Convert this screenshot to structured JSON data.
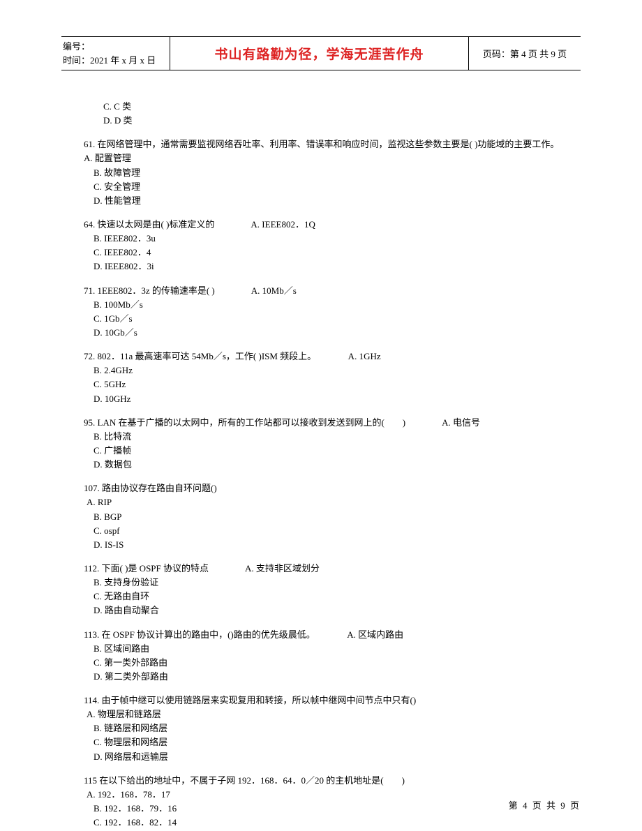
{
  "header": {
    "serial_label": "编号：",
    "time_label": "时间：",
    "time_value": "2021 年 x 月 x 日",
    "motto": "书山有路勤为径，学海无涯苦作舟",
    "page_label": "页码：",
    "page_value": "第 4 页 共 9 页"
  },
  "prev_opts": {
    "c": "C. C 类",
    "d": "D. D 类"
  },
  "q61": {
    "stem": "61. 在网络管理中，通常需要监视网络吞吐率、利用率、错误率和响应时间，监视这些参数主要是( )功能域的主要工作。　　　　A. 配置管理",
    "b": "B. 故障管理",
    "c": "C. 安全管理",
    "d": "D. 性能管理"
  },
  "q64": {
    "stem": "64.  快速以太网是由( )标准定义的　　　　A. IEEE802．1Q",
    "b": "B. IEEE802．3u",
    "c": "C. IEEE802．4",
    "d": "D. IEEE802．3i"
  },
  "q71": {
    "stem": "71. 1EEE802．3z 的传输速率是( )　　　　A. 10Mb／s",
    "b": "B. 100Mb／s",
    "c": "C. 1Gb／s",
    "d": "D. 10Gb／s"
  },
  "q72": {
    "stem": "72. 802．11a 最高速率可达 54Mb／s，工作( )ISM 频段上。　　　　A. 1GHz",
    "b": "B. 2.4GHz",
    "c": "C. 5GHz",
    "d": "D. 10GHz"
  },
  "q95": {
    "stem": "95. LAN 在基于广播的以太网中，所有的工作站都可以接收到发送到网上的(　　)　　　　A. 电信号",
    "b": "B. 比特流",
    "c": "C. 广播帧",
    "d": "D. 数据包"
  },
  "q107": {
    "stem": "107. 路由协议存在路由自环问题()",
    "a": "A. RIP",
    "b": "B. BGP",
    "c": "C. ospf",
    "d": "D. IS-IS"
  },
  "q112": {
    "stem": "112. 下面( )是 OSPF 协议的特点　　　　A. 支持非区域划分",
    "b": "B. 支持身份验证",
    "c": "C. 无路由自环",
    "d": "D. 路由自动聚合"
  },
  "q113": {
    "stem": "113. 在 OSPF 协议计算出的路由中，()路由的优先级晨低。　　　　A. 区域内路由",
    "b": "B. 区域间路由",
    "c": "C. 第一类外部路由",
    "d": "D. 第二类外部路由"
  },
  "q114": {
    "stem": "114. 由于帧中继可以使用链路层来实现复用和转接，所以帧中继网中间节点中只有()",
    "a": "A. 物理层和链路层",
    "b": "B. 链路层和网络层",
    "c": "C. 物理层和网络层",
    "d": "D. 网络层和运输层"
  },
  "q115": {
    "stem": "115 在以下给出的地址中，不属于子网 192．168．64．0／20 的主机地址是(　　)",
    "a": "A. 192．168．78．17",
    "b": "B. 192．168．79．16",
    "c": "C. 192．168．82．14"
  },
  "footer": "第 4 页 共 9 页"
}
